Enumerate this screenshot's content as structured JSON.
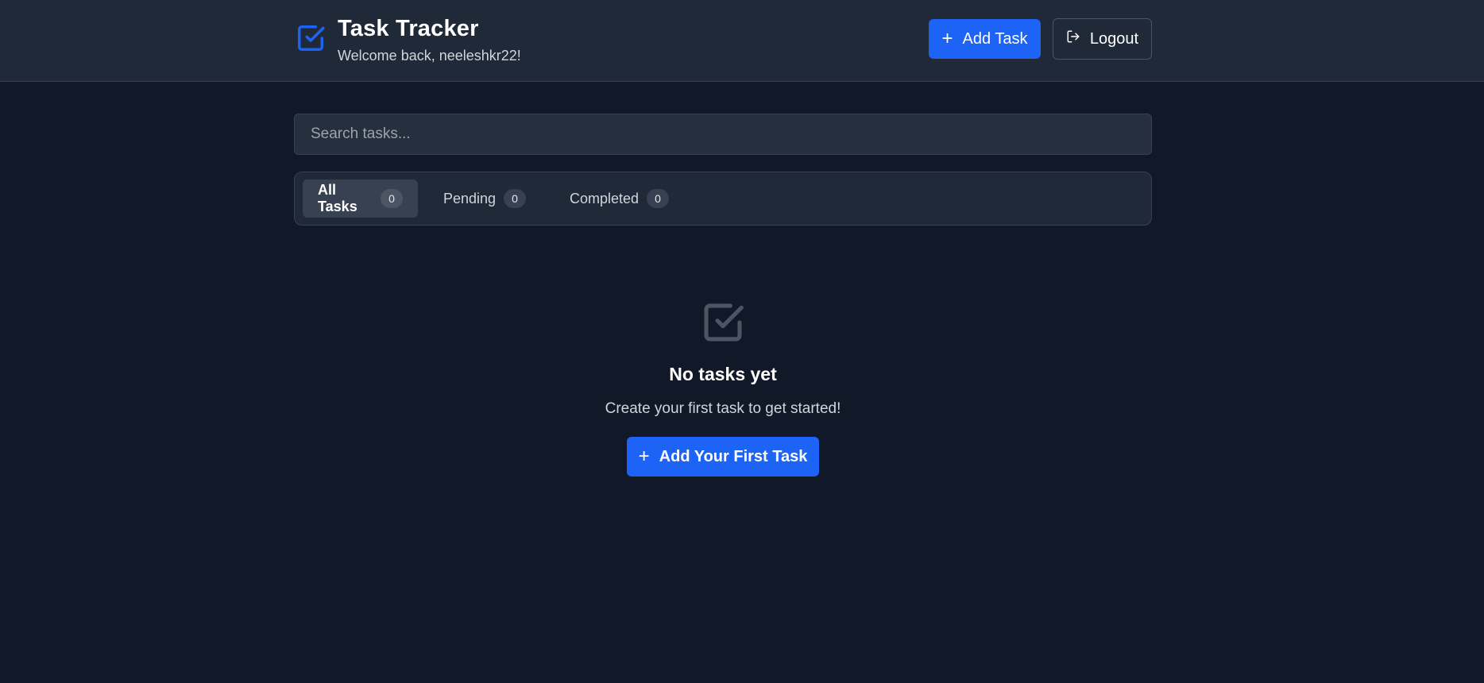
{
  "header": {
    "title": "Task Tracker",
    "welcome": "Welcome back, neeleshkr22!",
    "add_task_label": "Add Task",
    "logout_label": "Logout",
    "logo_icon": "check-square-icon"
  },
  "search": {
    "placeholder": "Search tasks...",
    "value": ""
  },
  "tabs": [
    {
      "label": "All Tasks",
      "count": "0",
      "active": true
    },
    {
      "label": "Pending",
      "count": "0",
      "active": false
    },
    {
      "label": "Completed",
      "count": "0",
      "active": false
    }
  ],
  "empty_state": {
    "icon": "check-square-icon",
    "title": "No tasks yet",
    "subtitle": "Create your first task to get started!",
    "button_label": "Add Your First Task"
  },
  "colors": {
    "background": "#111827",
    "header": "#1f2937",
    "accent": "#1d63f5",
    "border": "#374151"
  }
}
